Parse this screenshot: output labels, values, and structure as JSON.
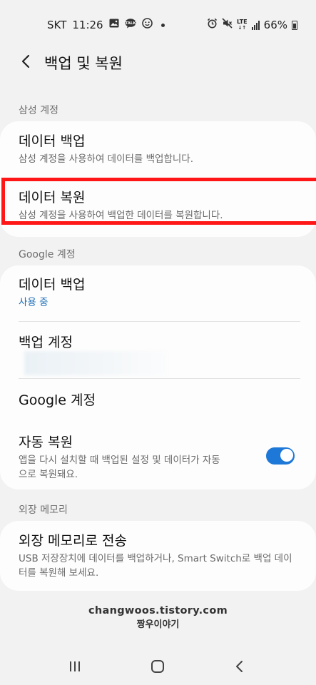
{
  "status_bar": {
    "carrier": "SKT",
    "time": "11:26",
    "network": "LTE",
    "battery": "66%"
  },
  "header": {
    "title": "백업 및 복원"
  },
  "sections": {
    "samsung": {
      "label": "삼성 계정",
      "backup_title": "데이터 백업",
      "backup_sub": "삼성 계정을 사용하여 데이터를 백업합니다.",
      "restore_title": "데이터 복원",
      "restore_sub": "삼성 계정을 사용하여 백업한 데이터를 복원합니다."
    },
    "google": {
      "label": "Google 계정",
      "backup_title": "데이터 백업",
      "backup_status": "사용 중",
      "backup_account_title": "백업 계정",
      "google_account_title": "Google 계정",
      "auto_restore_title": "자동 복원",
      "auto_restore_sub": "앱을 다시 설치할 때 백업된 설정 및 데이터가 자동으로 복원돼요.",
      "auto_restore_enabled": true
    },
    "external": {
      "label": "외장 메모리",
      "transfer_title": "외장 메모리로 전송",
      "transfer_sub": "USB 저장장치에 데이터를 백업하거나, Smart Switch로 백업 데이터를 복원해 보세요."
    }
  },
  "watermark": {
    "line1": "changwoos.tistory.com",
    "line2": "짱우이야기"
  },
  "colors": {
    "accent": "#1e78d8",
    "highlight": "#ff1616",
    "link": "#1f6fb8"
  }
}
